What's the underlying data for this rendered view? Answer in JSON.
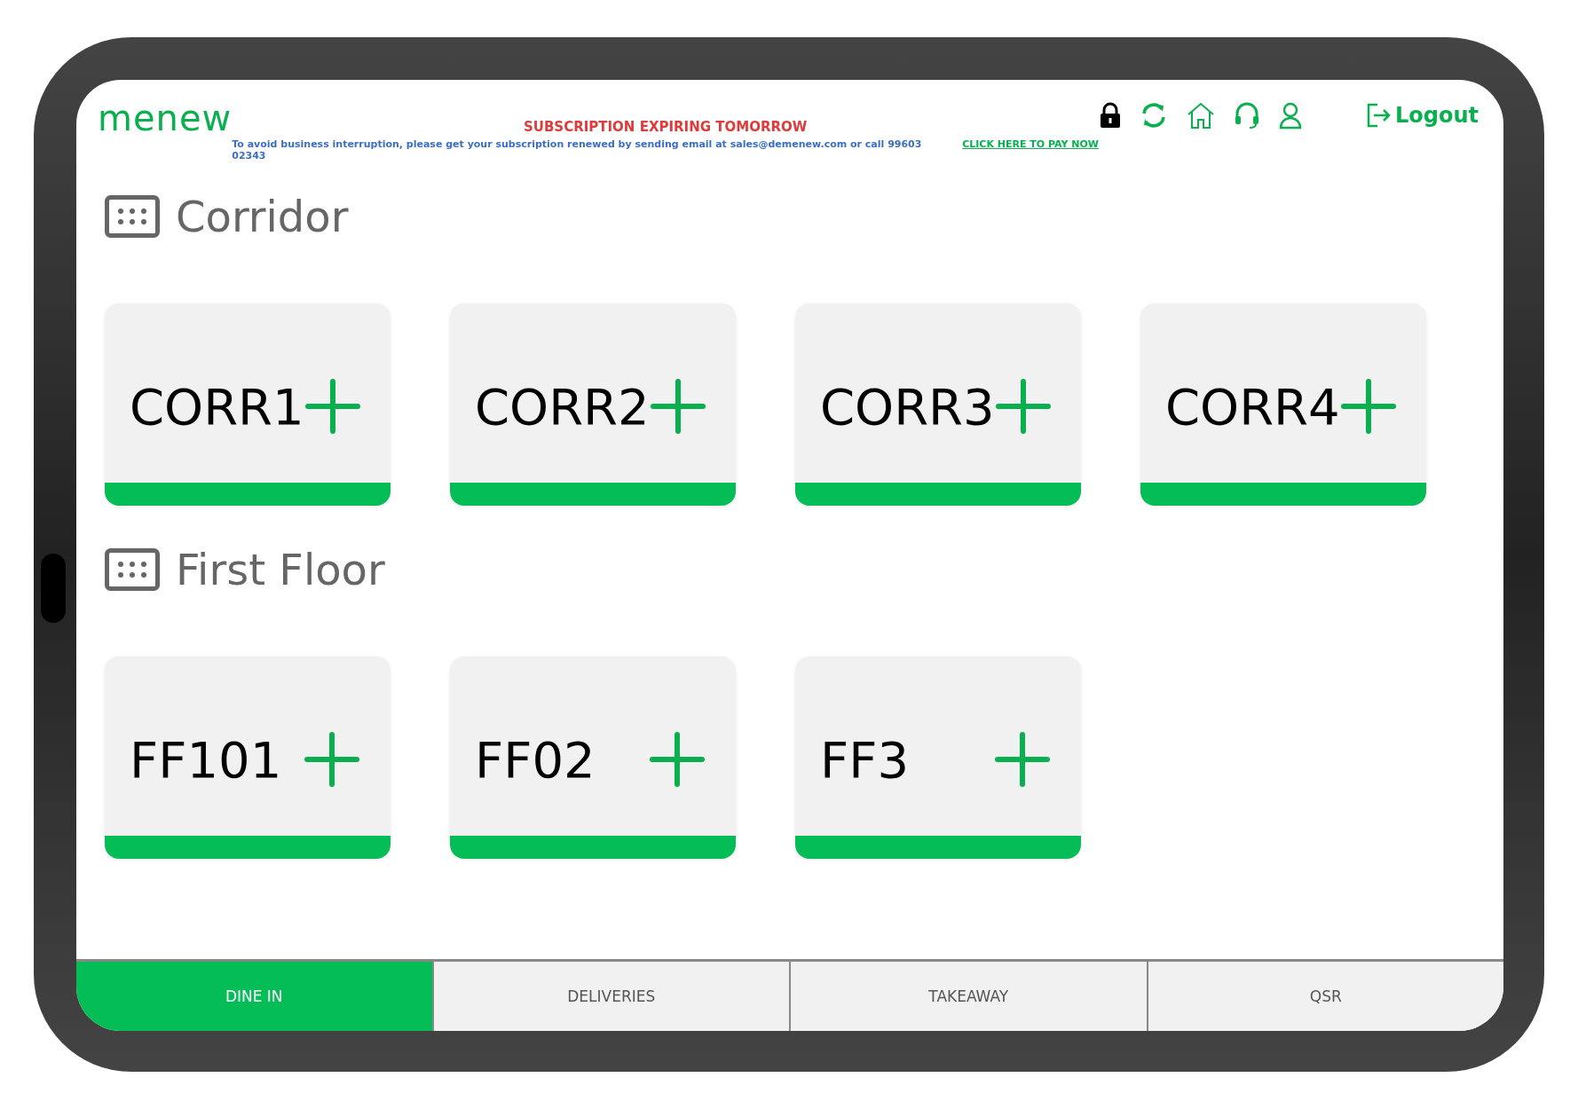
{
  "header": {
    "logo": "menew",
    "alert_title": "SUBSCRIPTION EXPIRING TOMORROW",
    "alert_message": "To avoid business interruption, please get your subscription renewed by sending email at sales@demenew.com or call 99603 02343",
    "pay_link": "CLICK HERE TO PAY NOW",
    "logout": "Logout"
  },
  "sections": [
    {
      "title": "Corridor",
      "tables": [
        {
          "name": "CORR1"
        },
        {
          "name": "CORR2"
        },
        {
          "name": "CORR3"
        },
        {
          "name": "CORR4"
        }
      ]
    },
    {
      "title": "First Floor",
      "tables": [
        {
          "name": "FF101"
        },
        {
          "name": "FF02"
        },
        {
          "name": "FF3"
        }
      ]
    }
  ],
  "tabs": [
    {
      "label": "DINE IN",
      "selected": true
    },
    {
      "label": "DELIVERIES",
      "selected": false
    },
    {
      "label": "TAKEAWAY",
      "selected": false
    },
    {
      "label": "QSR",
      "selected": false
    }
  ]
}
